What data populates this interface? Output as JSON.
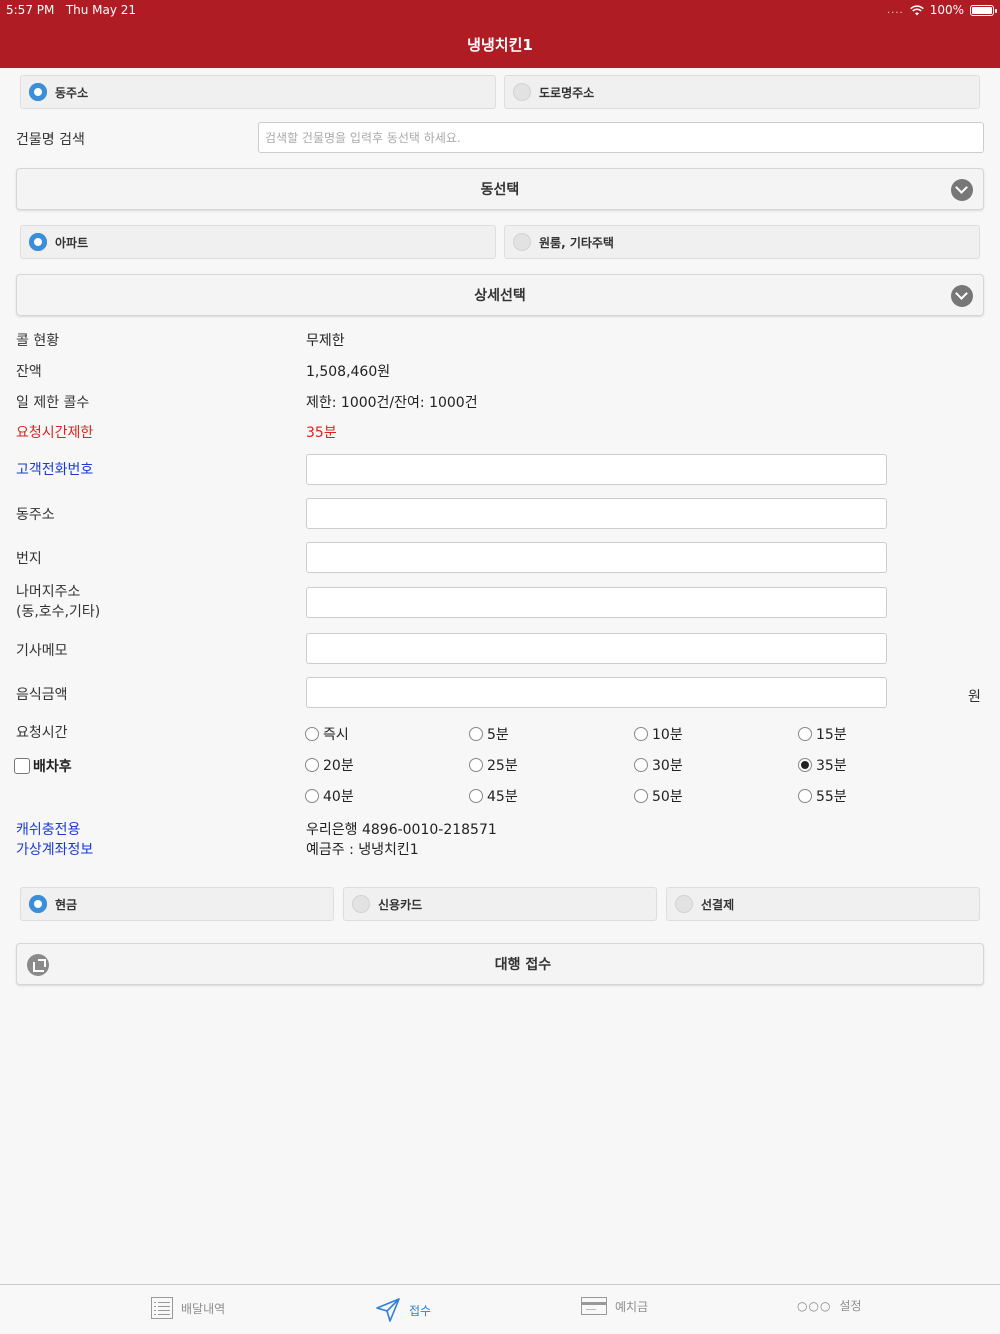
{
  "status": {
    "time": "5:57 PM",
    "date": "Thu May 21",
    "battery": "100%"
  },
  "nav": {
    "title": "냉냉치킨1"
  },
  "address_type": {
    "options": [
      "동주소",
      "도로명주소"
    ],
    "selected": 0
  },
  "building_search": {
    "label": "건물명 검색",
    "placeholder": "검색할 건물명을 입력후 동선택 하세요."
  },
  "dong_select": {
    "label": "동선택"
  },
  "housing_type": {
    "options": [
      "아파트",
      "원룸, 기타주택"
    ],
    "selected": 0
  },
  "detail_select": {
    "label": "상세선택"
  },
  "info": {
    "call_status_label": "콜 현황",
    "call_status_value": "무제한",
    "balance_label": "잔액",
    "balance_value": "1,508,460원",
    "daily_limit_label": "일 제한 콜수",
    "daily_limit_value": "제한: 1000건/잔여: 1000건",
    "request_time_limit_label": "요청시간제한",
    "request_time_limit_value": "35분"
  },
  "form": {
    "phone_label": "고객전화번호",
    "dong_label": "동주소",
    "lot_label": "번지",
    "rest_label_1": "나머지주소",
    "rest_label_2": "(동,호수,기타)",
    "memo_label": "기사메모",
    "amount_label": "음식금액",
    "amount_unit": "원"
  },
  "request_time": {
    "label": "요청시간",
    "after_dispatch_label": "배차후",
    "options": [
      "즉시",
      "5분",
      "10분",
      "15분",
      "20분",
      "25분",
      "30분",
      "35분",
      "40분",
      "45분",
      "50분",
      "55분"
    ],
    "selected": "35분"
  },
  "virtual_account": {
    "label_1": "캐쉬충전용",
    "label_2": "가상계좌정보",
    "bank": "우리은행 4896-0010-218571",
    "holder": "예금주 : 냉냉치킨1"
  },
  "payment": {
    "options": [
      "현금",
      "신용카드",
      "선결제"
    ],
    "selected": 0
  },
  "submit": {
    "label": "대행 접수"
  },
  "tabs": [
    {
      "label": "배달내역",
      "icon": "list-icon"
    },
    {
      "label": "접수",
      "icon": "send-icon"
    },
    {
      "label": "예치금",
      "icon": "card-icon"
    },
    {
      "label": "설정",
      "icon": "more-icon"
    }
  ],
  "colors": {
    "header": "#b01c24",
    "accent": "#3b8ed8",
    "red": "#e02020",
    "blue": "#1a3ad8",
    "tab_active": "#2f7fd6"
  }
}
